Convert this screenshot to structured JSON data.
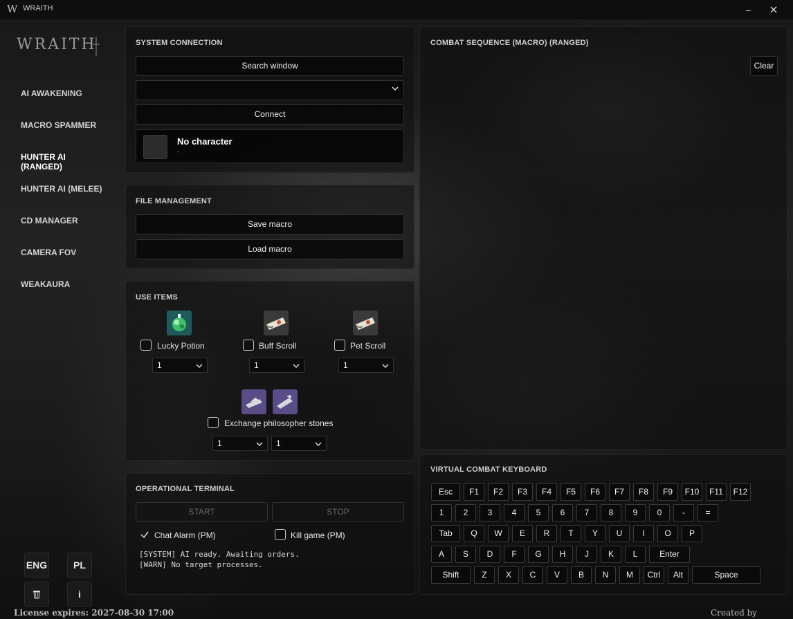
{
  "window": {
    "logo_glyph": "W",
    "title": "WRAITH",
    "minimize_glyph": "_",
    "close_glyph": "×"
  },
  "brand": "WRAITH",
  "sidebar": {
    "items": [
      {
        "label": "AI AWAKENING"
      },
      {
        "label": "MACRO SPAMMER"
      },
      {
        "label": "HUNTER AI (RANGED)",
        "active": true
      },
      {
        "label": "HUNTER AI (MELEE)"
      },
      {
        "label": "CD MANAGER"
      },
      {
        "label": "CAMERA FOV"
      },
      {
        "label": "WEAKAURA"
      }
    ],
    "lang_eng": "ENG",
    "lang_pl": "PL",
    "info_label": "i",
    "trash_icon": "trash-icon"
  },
  "footer": {
    "license": "License expires: 2027-08-30 17:00",
    "credit": "Created by WRAITH"
  },
  "system_connection": {
    "title": "SYSTEM CONNECTION",
    "search_label": "Search window",
    "window_value": "",
    "connect_label": "Connect",
    "character_name": "No character",
    "character_sub": "-"
  },
  "file_management": {
    "title": "FILE MANAGEMENT",
    "save_label": "Save macro",
    "load_label": "Load macro"
  },
  "use_items": {
    "title": "USE ITEMS",
    "items": [
      {
        "label": "Lucky Potion",
        "qty": "1",
        "checked": false,
        "icon": "potion-icon"
      },
      {
        "label": "Buff Scroll",
        "qty": "1",
        "checked": false,
        "icon": "scroll-icon"
      },
      {
        "label": "Pet Scroll",
        "qty": "1",
        "checked": false,
        "icon": "scroll-icon"
      }
    ],
    "exchange": {
      "label": "Exchange philosopher stones",
      "qty_a": "1",
      "qty_b": "1",
      "checked": false,
      "icon": "stone-icon"
    }
  },
  "terminal": {
    "title": "OPERATIONAL TERMINAL",
    "start_label": "START",
    "stop_label": "STOP",
    "chat_alarm": {
      "label": "Chat Alarm (PM)",
      "checked": true
    },
    "kill_game": {
      "label": "Kill game (PM)",
      "checked": false
    },
    "log": [
      "[SYSTEM] AI ready. Awaiting orders.",
      "[WARN] No target processes."
    ]
  },
  "combat_sequence": {
    "title": "COMBAT SEQUENCE (MACRO) (RANGED)",
    "clear_label": "Clear"
  },
  "keyboard": {
    "title": "VIRTUAL COMBAT KEYBOARD",
    "rows": [
      [
        "Esc",
        "F1",
        "F2",
        "F3",
        "F4",
        "F5",
        "F6",
        "F7",
        "F8",
        "F9",
        "F10",
        "F11",
        "F12"
      ],
      [
        "1",
        "2",
        "3",
        "4",
        "5",
        "6",
        "7",
        "8",
        "9",
        "0",
        "-",
        "="
      ],
      [
        "Tab",
        "Q",
        "W",
        "E",
        "R",
        "T",
        "Y",
        "U",
        "I",
        "O",
        "P"
      ],
      [
        "A",
        "S",
        "D",
        "F",
        "G",
        "H",
        "J",
        "K",
        "L",
        "Enter"
      ],
      [
        "Shift",
        "Z",
        "X",
        "C",
        "V",
        "B",
        "N",
        "M",
        "Ctrl",
        "Alt",
        "Space"
      ]
    ]
  },
  "colors": {
    "panel_bg": "#101010",
    "text": "#e8e8e8",
    "button_bg": "#080808"
  }
}
